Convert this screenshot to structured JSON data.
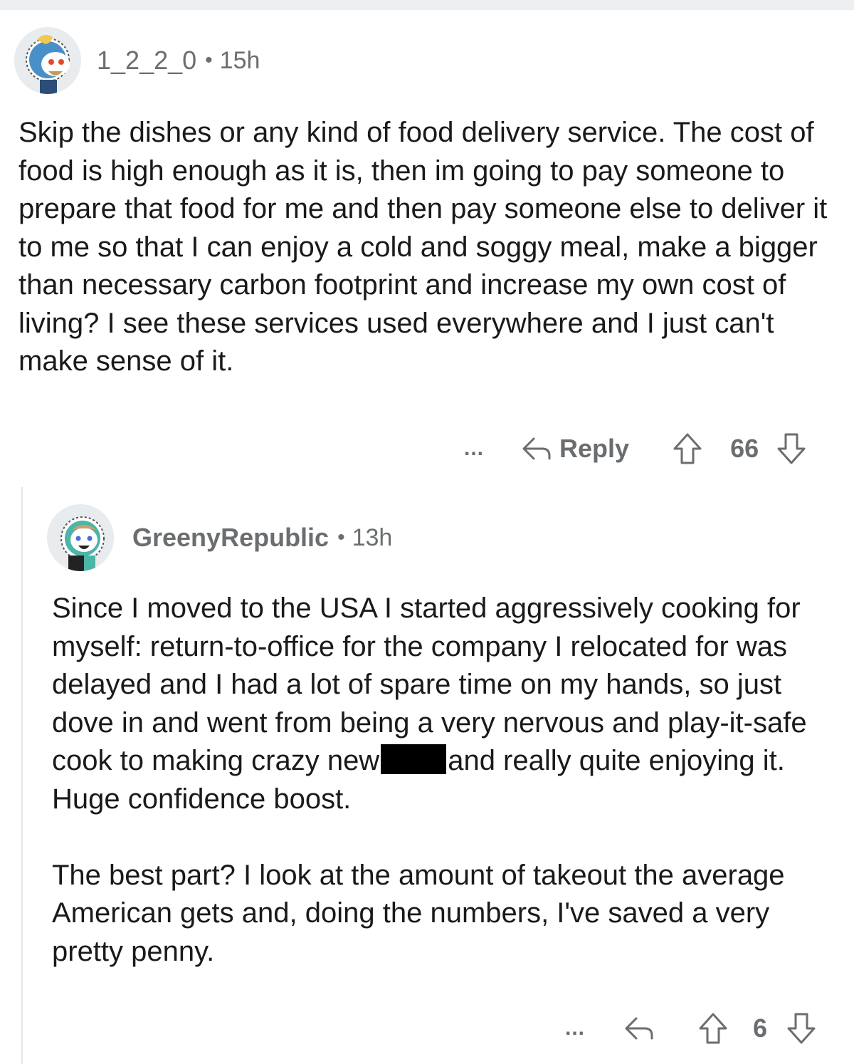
{
  "comments": [
    {
      "username": "1_2_2_0",
      "time": "15h",
      "body": "Skip the dishes or any kind of food delivery service. The cost of food is high enough as it is, then im going to pay someone to prepare that food for me and then pay someone else to deliver it to me so that I can enjoy a cold and soggy meal, make a bigger than necessary carbon footprint and increase my own cost of living? I see these services used everywhere and I just can't make sense of it.",
      "actions": {
        "more": "...",
        "reply_label": "Reply",
        "score": "66"
      }
    },
    {
      "username": "GreenyRepublic",
      "time": "13h",
      "body_p1_before": "Since I moved to the USA I started aggressively cooking for myself: return-to-office for the company I relocated for was delayed and I had a lot of spare time on my hands, so just dove in and went from being a very nervous and play-it-safe cook to making crazy new",
      "body_p1_after": "and really quite enjoying it. Huge confidence boost.",
      "body_p2": "The best part? I look at the amount of takeout the average American gets and, doing the numbers, I've saved a very pretty penny.",
      "actions": {
        "more": "...",
        "score": "6"
      }
    }
  ],
  "icons": {
    "more": "more-icon",
    "reply": "reply-arrow-icon",
    "upvote": "upvote-arrow-icon",
    "downvote": "downvote-arrow-icon"
  },
  "colors": {
    "meta_text": "#6b6e70",
    "body_text": "#1a1a1b",
    "thread_line": "#e3e5e7",
    "redaction": "#000000"
  }
}
